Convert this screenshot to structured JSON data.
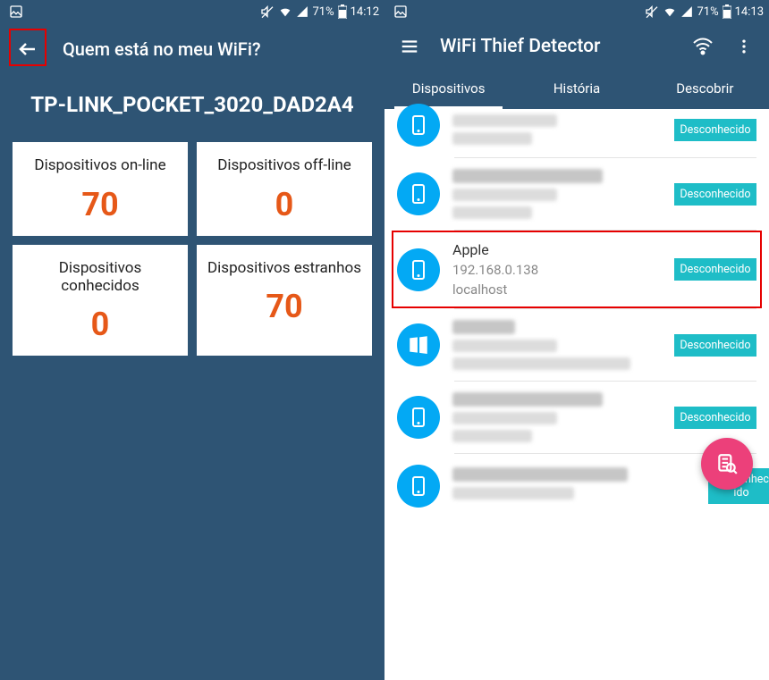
{
  "status_bar": {
    "battery": "71%",
    "time_left": "14:12",
    "time_right": "14:13"
  },
  "left": {
    "title": "Quem está no meu WiFi?",
    "network_name": "TP-LINK_POCKET_3020_DAD2A4",
    "stats": [
      {
        "label": "Dispositivos on-line",
        "value": "70"
      },
      {
        "label": "Dispositivos off-line",
        "value": "0"
      },
      {
        "label": "Dispositivos conhecidos",
        "value": "0"
      },
      {
        "label": "Dispositivos estranhos",
        "value": "70"
      }
    ]
  },
  "right": {
    "title": "WiFi Thief Detector",
    "tabs": {
      "devices": "Dispositivos",
      "history": "História",
      "discover": "Descobrir"
    },
    "badge_label": "Desconhecido",
    "devices": [
      {
        "icon": "phone",
        "name": "",
        "ip": "",
        "host": "",
        "blurred": true,
        "partial": true
      },
      {
        "icon": "phone",
        "name": "",
        "ip": "",
        "host": "",
        "blurred": true
      },
      {
        "icon": "phone",
        "name": "Apple",
        "ip": "192.168.0.138",
        "host": "localhost",
        "blurred": false,
        "highlight": true
      },
      {
        "icon": "windows",
        "name": "",
        "ip": "",
        "host": "",
        "blurred": true
      },
      {
        "icon": "phone",
        "name": "",
        "ip": "",
        "host": "",
        "blurred": true
      },
      {
        "icon": "phone",
        "name": "",
        "ip": "",
        "host": "",
        "blurred": true,
        "fab_overlap": true
      }
    ]
  }
}
